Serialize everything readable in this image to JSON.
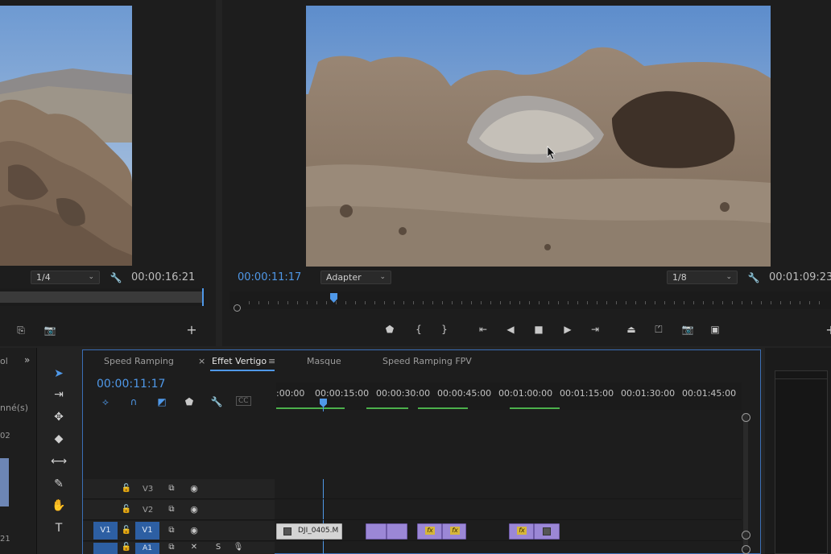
{
  "source_monitor": {
    "zoom": "1/4",
    "timecode": "00:00:16:21"
  },
  "program_monitor": {
    "current_timecode": "00:00:11:17",
    "fit_label": "Adapter",
    "resolution": "1/8",
    "duration": "00:01:09:23"
  },
  "left_panel": {
    "label_fragment": "nné(s)",
    "label_fragment_2": "ol",
    "num_fragment": "02",
    "num_fragment_2": "21"
  },
  "timeline": {
    "tabs": [
      {
        "label": "Speed Ramping"
      },
      {
        "label": "Effet Vertigo"
      },
      {
        "label": "Masque"
      },
      {
        "label": "Speed Ramping FPV"
      }
    ],
    "active_tab_close": "×",
    "active_tab_menu": "≡",
    "current_timecode": "00:00:11:17",
    "ruler_labels": [
      ":00:00",
      "00:00:15:00",
      "00:00:30:00",
      "00:00:45:00",
      "00:01:00:00",
      "00:01:15:00",
      "00:01:30:00",
      "00:01:45:00"
    ],
    "tracks": {
      "v3": "V3",
      "v2": "V2",
      "v1": "V1",
      "v1_source": "V1",
      "a1": "A1"
    },
    "clip_name": "DJI_0405.M",
    "fx_label": "fx",
    "cc_label": "CC"
  },
  "colors": {
    "accent_blue": "#4f98e8",
    "clip_purple": "#9b87d6",
    "fx_yellow": "#d6b63a",
    "render_green": "#4bb04b"
  }
}
